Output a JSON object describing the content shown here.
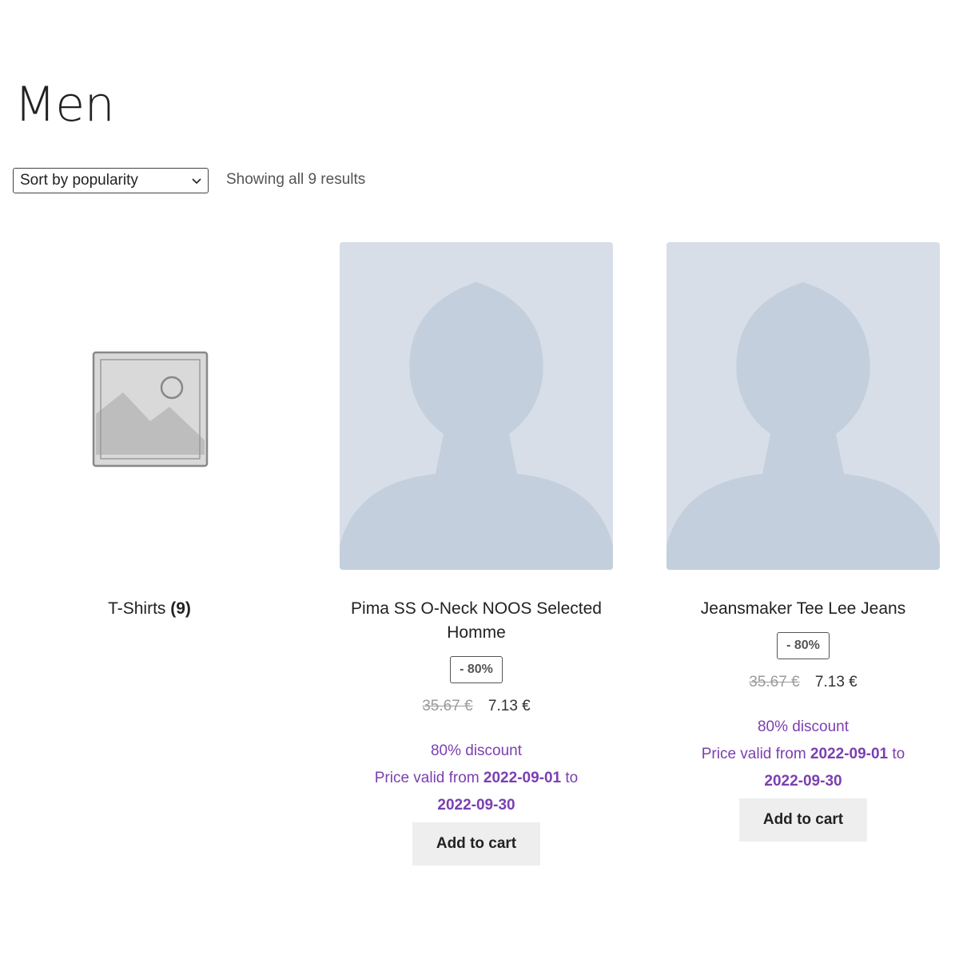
{
  "page": {
    "title": "Men"
  },
  "toolbar": {
    "sort_selected": "Sort by popularity",
    "result_count": "Showing all 9 results"
  },
  "category": {
    "name": "T-Shirts",
    "count": "(9)"
  },
  "products": [
    {
      "title": "Pima SS O-Neck NOOS Selected Homme",
      "badge": "- 80%",
      "old_price": "35.67 €",
      "price": "7.13 €",
      "discount_line": "80% discount",
      "valid_prefix": "Price valid from",
      "valid_from": "2022-09-01",
      "valid_to_word": "to",
      "valid_to": "2022-09-30",
      "button": "Add to cart"
    },
    {
      "title": "Jeansmaker Tee Lee Jeans",
      "badge": "- 80%",
      "old_price": "35.67 €",
      "price": "7.13 €",
      "discount_line": "80% discount",
      "valid_prefix": "Price valid from",
      "valid_from": "2022-09-01",
      "valid_to_word": "to",
      "valid_to": "2022-09-30",
      "button": "Add to cart"
    }
  ],
  "colors": {
    "accent": "#7b3fb0",
    "button_bg": "#eeeeee",
    "thumb_bg": "#d7dee8",
    "silhouette": "#c3cfdd"
  }
}
